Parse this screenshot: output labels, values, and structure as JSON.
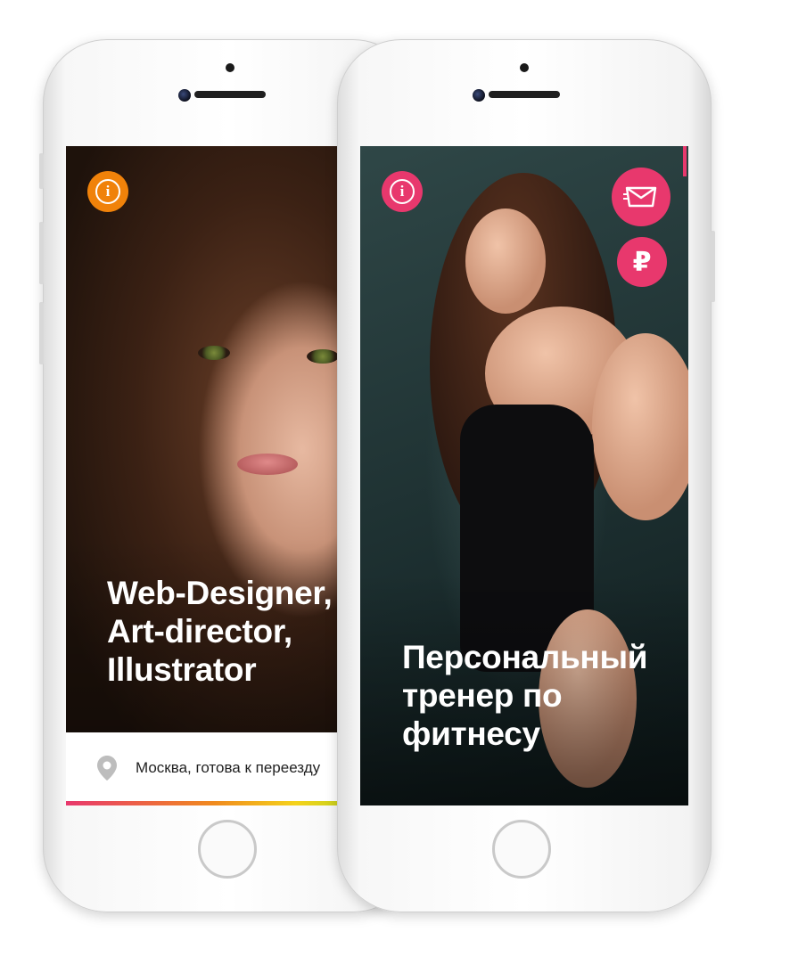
{
  "colors": {
    "accent_orange": "#f0820a",
    "accent_pink": "#e8386d"
  },
  "phone_left": {
    "info_icon_glyph": "i",
    "headline": "Web-Designer,\nArt-director,\nIllustrator",
    "location": "Москва, готова к переезду"
  },
  "phone_right": {
    "info_icon_glyph": "i",
    "currency_glyph": "₽",
    "headline": "Персональный\nтренер по\nфитнесу"
  }
}
